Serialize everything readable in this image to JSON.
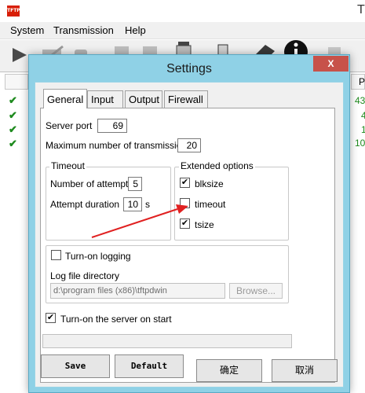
{
  "main_window": {
    "icon_text": "TFTP",
    "title_partial": "T",
    "menu": [
      "System",
      "Transmission",
      "Help"
    ],
    "toolbar_icons": [
      "play-icon",
      "stop-icon",
      "trash-icon",
      "document-icon",
      "document-icon",
      "document-icon",
      "recycle-bin-icon",
      "server-icon",
      "tag-icon",
      "info-icon"
    ],
    "list_header_right": "P",
    "row_status": [
      "✔",
      "✔",
      "✔",
      "✔"
    ],
    "right_values": [
      "43",
      "4",
      "1",
      "10"
    ]
  },
  "dialog": {
    "title": "Settings",
    "close_symbol": "X",
    "tabs": [
      "General",
      "Input",
      "Output",
      "Firewall"
    ],
    "active_tab": "General",
    "server_port": {
      "label": "Server port",
      "value": "69"
    },
    "max_transmissions": {
      "label": "Maximum number of transmissions",
      "value": "20"
    },
    "timeout_group": {
      "title": "Timeout",
      "attempts": {
        "label": "Number of attempts",
        "value": "5"
      },
      "duration": {
        "label": "Attempt duration",
        "value": "10",
        "unit": "s"
      }
    },
    "extended_group": {
      "title": "Extended options",
      "options": [
        {
          "label": "blksize",
          "checked": true
        },
        {
          "label": "timeout",
          "checked": false
        },
        {
          "label": "tsize",
          "checked": true
        }
      ]
    },
    "logging": {
      "label": "Turn-on logging",
      "checked": false,
      "dir_label": "Log file directory",
      "dir_value": "d:\\program files (x86)\\tftpdwin",
      "browse_label": "Browse..."
    },
    "start_server": {
      "label": "Turn-on the server on start",
      "checked": true
    },
    "buttons": {
      "save": "Save",
      "default": "Default",
      "ok": "确定",
      "cancel": "取消"
    }
  },
  "annotation": {
    "color": "#e02020"
  }
}
